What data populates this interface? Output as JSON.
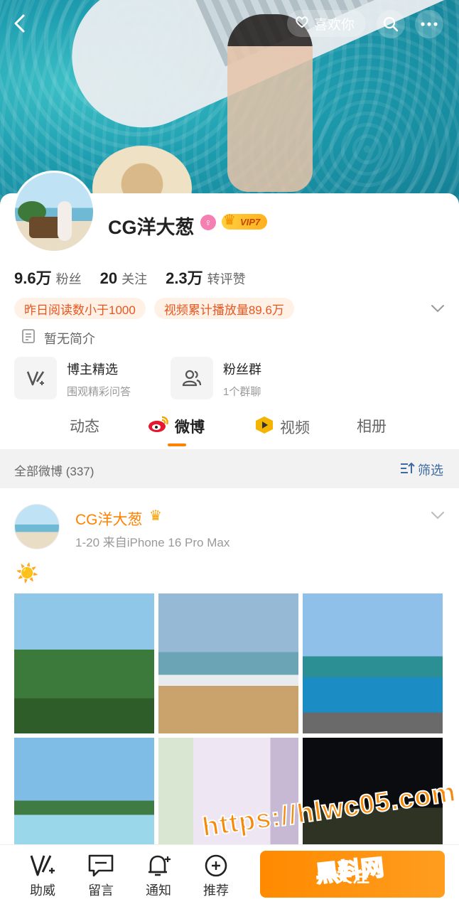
{
  "header": {
    "like_label": "喜欢你"
  },
  "profile": {
    "name": "CG洋大葱",
    "gender_symbol": "♀",
    "vip_label": "VIP7",
    "stats": [
      {
        "num": "9.6万",
        "label": "粉丝"
      },
      {
        "num": "20",
        "label": "关注"
      },
      {
        "num": "2.3万",
        "label": "转评赞"
      }
    ],
    "tags": [
      "昨日阅读数小于1000",
      "视频累计播放量89.6万"
    ],
    "bio": "暂无简介",
    "features": [
      {
        "title": "博主精选",
        "subtitle": "围观精彩问答",
        "icon": "pen-icon"
      },
      {
        "title": "粉丝群",
        "subtitle": "1个群聊",
        "icon": "group-icon"
      }
    ]
  },
  "tabs": {
    "items": [
      "动态",
      "微博",
      "视频",
      "相册"
    ],
    "active": "微博"
  },
  "filterbar": {
    "count": "全部微博 (337)",
    "filter_label": "筛选"
  },
  "post": {
    "author": "CG洋大葱",
    "meta": "1-20  来自iPhone 16 Pro Max",
    "content": "☀️"
  },
  "bottom_nav": {
    "items": [
      {
        "label": "助威",
        "icon": "boost-icon"
      },
      {
        "label": "留言",
        "icon": "message-icon"
      },
      {
        "label": "通知",
        "icon": "bell-icon"
      },
      {
        "label": "推荐",
        "icon": "recommend-icon"
      }
    ],
    "follow_label": "关注"
  },
  "watermark": {
    "url": "https://hlwc05.com",
    "brand": "黑料网"
  },
  "colors": {
    "accent": "#ff8200",
    "link": "#3d6aa2",
    "tag_bg": "#fff1e6",
    "tag_text": "#e8561f"
  }
}
